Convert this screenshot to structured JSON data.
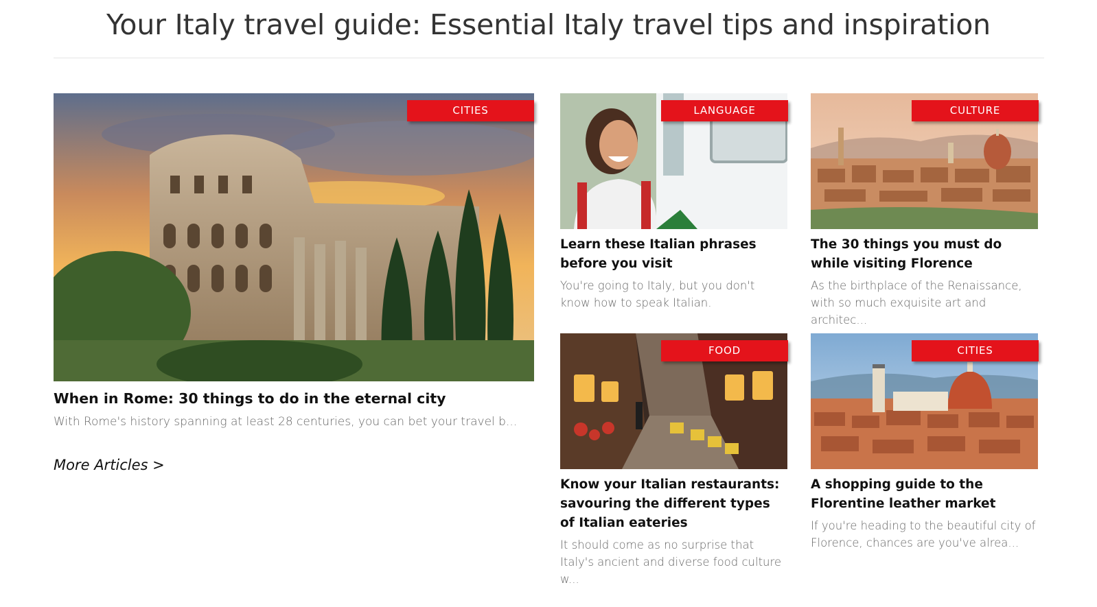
{
  "page": {
    "title": "Your Italy travel guide: Essential Italy travel tips and inspiration"
  },
  "featured": {
    "category": "CITIES",
    "title": "When in Rome: 30 things to do in the eternal city",
    "excerpt": "With Rome's history spanning at least 28 centuries, you can bet your travel b...",
    "image": "colosseum-sunset-photo"
  },
  "more_link": "More Articles >",
  "articles": [
    {
      "category": "LANGUAGE",
      "title": "Learn these Italian phrases before you visit",
      "excerpt": "You're going to Italy, but you don't know how to speak Italian.",
      "image": "smiling-traveler-train-photo"
    },
    {
      "category": "CULTURE",
      "title": "The 30 things you must do while visiting Florence",
      "excerpt": "As the birthplace of the Renaissance, with so much exquisite art and architec...",
      "image": "florence-skyline-photo"
    },
    {
      "category": "FOOD",
      "title": "Know your Italian restaurants: savouring the different types of Italian eateries",
      "excerpt": "It should come as no surprise that Italy's ancient and diverse food culture w...",
      "image": "venice-restaurant-street-photo"
    },
    {
      "category": "CITIES",
      "title": "A shopping guide to the Florentine leather market",
      "excerpt": "If you're heading to the beautiful city of Florence, chances are you've alrea...",
      "image": "florence-duomo-rooftops-photo"
    }
  ],
  "colors": {
    "badge": "#e4131b",
    "text": "#111111",
    "muted": "#666666"
  }
}
